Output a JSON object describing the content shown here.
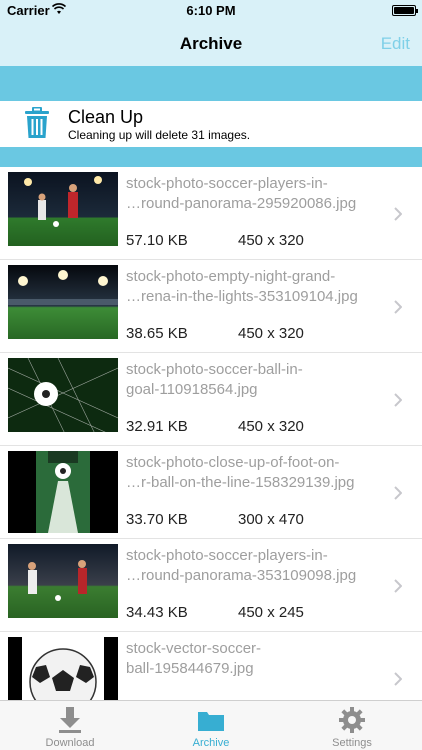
{
  "status_bar": {
    "carrier": "Carrier",
    "time": "6:10 PM"
  },
  "nav": {
    "title": "Archive",
    "edit_label": "Edit"
  },
  "cleanup": {
    "title": "Clean Up",
    "subtitle": "Cleaning up will delete 31 images.",
    "icon": "trash-icon"
  },
  "items": [
    {
      "name": "stock-photo-soccer-players-in-\n…round-panorama-295920086.jpg",
      "size": "57.10 KB",
      "dims": "450 x 320"
    },
    {
      "name": "stock-photo-empty-night-grand-\n…rena-in-the-lights-353109104.jpg",
      "size": "38.65 KB",
      "dims": "450 x 320"
    },
    {
      "name": "stock-photo-soccer-ball-in-\ngoal-110918564.jpg",
      "size": "32.91 KB",
      "dims": "450 x 320"
    },
    {
      "name": "stock-photo-close-up-of-foot-on-\n…r-ball-on-the-line-158329139.jpg",
      "size": "33.70 KB",
      "dims": "300 x 470"
    },
    {
      "name": "stock-photo-soccer-players-in-\n…round-panorama-353109098.jpg",
      "size": "34.43 KB",
      "dims": "450 x 245"
    },
    {
      "name": "stock-vector-soccer-\nball-195844679.jpg",
      "size": "",
      "dims": ""
    }
  ],
  "tabs": [
    {
      "label": "Download",
      "icon": "download-icon"
    },
    {
      "label": "Archive",
      "icon": "folder-icon",
      "active": true
    },
    {
      "label": "Settings",
      "icon": "gear-icon"
    }
  ],
  "colors": {
    "accent": "#37aed2",
    "band": "#6ac8e2",
    "header_bg": "#d9f1f8",
    "edit": "#7fd0e8"
  }
}
